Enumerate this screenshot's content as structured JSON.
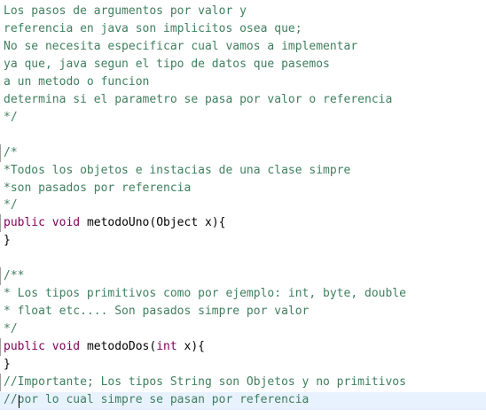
{
  "editor": {
    "lines": [
      {
        "text": "Los pasos de argumentos por valor y",
        "kind": "doc"
      },
      {
        "text": "referencia en java son implicitos osea que;",
        "kind": "doc"
      },
      {
        "text": "No se necesita especificar cual vamos a implementar",
        "kind": "doc"
      },
      {
        "text": "ya que, java segun el tipo de datos que pasemos",
        "kind": "doc"
      },
      {
        "text": "a un metodo o funcion",
        "kind": "doc"
      },
      {
        "text": "determina si el parametro se pasa por valor o referencia",
        "kind": "doc"
      },
      {
        "text": "*/",
        "kind": "doc"
      },
      {
        "text": "",
        "kind": "blank"
      },
      {
        "text": "/*",
        "kind": "doc"
      },
      {
        "text": "*Todos los objetos e instacias de una clase simpre",
        "kind": "doc"
      },
      {
        "text": "*son pasados por referencia",
        "kind": "doc"
      },
      {
        "text": "*/",
        "kind": "doc"
      },
      {
        "kind": "code",
        "segments": [
          {
            "text": "public ",
            "cls": "kw"
          },
          {
            "text": "void ",
            "cls": "kw"
          },
          {
            "text": "metodoUno(Object x){",
            "cls": "plain"
          }
        ]
      },
      {
        "text": "}",
        "kind": "plain"
      },
      {
        "text": "",
        "kind": "blank"
      },
      {
        "text": "/**",
        "kind": "doc"
      },
      {
        "text": "* Los tipos primitivos como por ejemplo: int, byte, double",
        "kind": "doc"
      },
      {
        "text": "* float etc.... Son pasados simpre por valor",
        "kind": "doc"
      },
      {
        "text": "*/",
        "kind": "doc"
      },
      {
        "kind": "code",
        "segments": [
          {
            "text": "public ",
            "cls": "kw"
          },
          {
            "text": "void ",
            "cls": "kw"
          },
          {
            "text": "metodoDos(",
            "cls": "plain"
          },
          {
            "text": "int",
            "cls": "kw"
          },
          {
            "text": " x){",
            "cls": "plain"
          }
        ]
      },
      {
        "text": "}",
        "kind": "plain"
      },
      {
        "text": "//Importante; Los tipos String son Objetos y no primitivos",
        "kind": "doc"
      },
      {
        "text": "//por lo cual simpre se pasan por referencia",
        "kind": "doc"
      }
    ]
  }
}
